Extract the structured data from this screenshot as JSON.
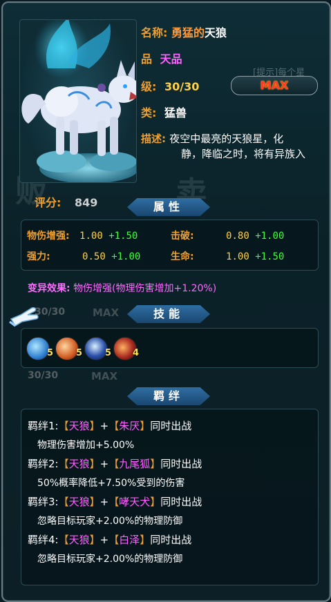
{
  "pet": {
    "name_label": "名称:",
    "name_prefix": "勇猛的",
    "name_main": "天狼",
    "grade_label": "品",
    "grade_value": "天品",
    "level_label": "级:",
    "level_value": "30/30",
    "max_label": "MAX",
    "type_label": "类:",
    "type_value": "猛兽",
    "desc_label": "描述:",
    "desc_line1": "夜空中最亮的天狼星，化",
    "desc_line2": "静，降临之时，将有异族入",
    "score_label": "评分:",
    "score_value": "849"
  },
  "background": {
    "hint": "[提示]每个星",
    "ghost1": "贩",
    "ghost2": "卖",
    "ghost_level": "30/30",
    "ghost_max": "MAX",
    "ghost_level2": "30/30",
    "ghost_max2": "MAX"
  },
  "attributes": {
    "header": "属性",
    "items": [
      {
        "label": "物伤增强:",
        "value": "1.00",
        "bonus": "+1.50"
      },
      {
        "label": "击破:",
        "value": "0.80",
        "bonus": "+1.00"
      },
      {
        "label": "强力:",
        "value": "0.50",
        "bonus": "+1.00"
      },
      {
        "label": "生命:",
        "value": "1.00",
        "bonus": "+1.50"
      }
    ]
  },
  "mutation": {
    "label": "变异效果:",
    "value": "物伤增强(物理伤害增加+1.20%)"
  },
  "skills": {
    "header": "技能",
    "items": [
      {
        "icon": "wind-blade-icon",
        "level": "5",
        "color": "#2f7fd0"
      },
      {
        "icon": "fire-claw-icon",
        "level": "5",
        "color": "#d05a20"
      },
      {
        "icon": "shadow-wolf-icon",
        "level": "5",
        "color": "#2a4fa8"
      },
      {
        "icon": "flame-beast-icon",
        "level": "4",
        "color": "#a82a20"
      }
    ]
  },
  "bonds": {
    "header": "羁绊",
    "items": [
      {
        "label": "羁绊1:",
        "pet_a": "天狼",
        "pet_b": "朱厌",
        "suffix": "同时出战",
        "effect": "物理伤害增加+5.00%"
      },
      {
        "label": "羁绊2:",
        "pet_a": "天狼",
        "pet_b": "九尾狐",
        "suffix": "同时出战",
        "effect": "50%概率降低+7.50%受到的伤害"
      },
      {
        "label": "羁绊3:",
        "pet_a": "天狼",
        "pet_b": "哮天犬",
        "suffix": "同时出战",
        "effect": "忽略目标玩家+2.00%的物理防御"
      },
      {
        "label": "羁绊4:",
        "pet_a": "天狼",
        "pet_b": "白泽",
        "suffix": "同时出战",
        "effect": "忽略目标玩家+2.00%的物理防御"
      }
    ]
  },
  "colors": {
    "label_orange": "#f0a030",
    "value_gold": "#ffd04a",
    "bonus_green": "#3dff3d",
    "pet_purple": "#ff60ff",
    "header_blue": "#2f6ea3"
  }
}
